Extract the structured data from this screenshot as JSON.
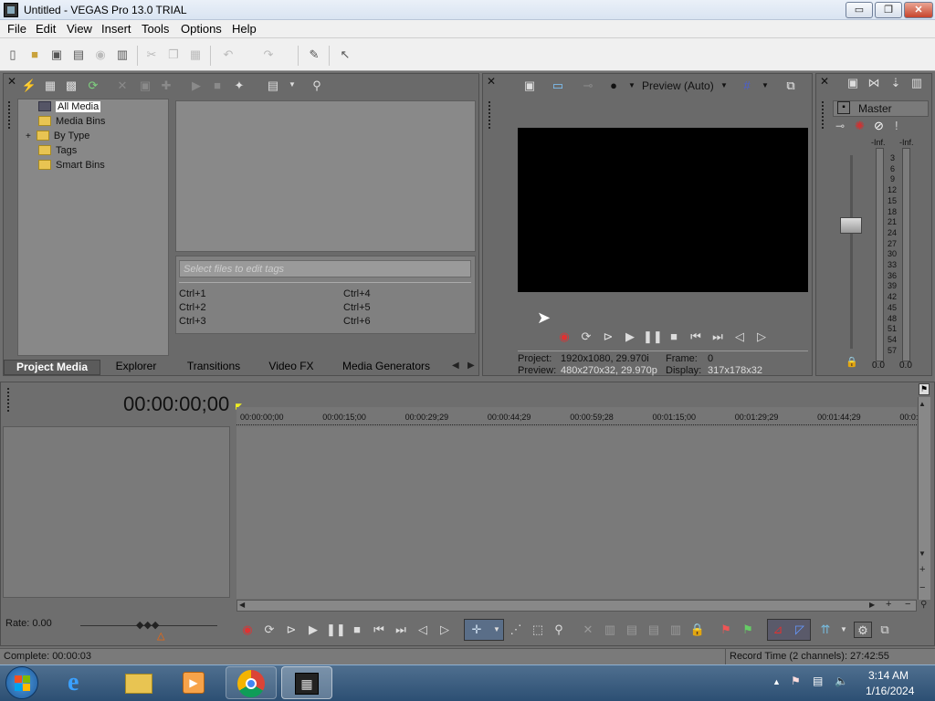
{
  "window": {
    "title": "Untitled - VEGAS Pro 13.0 TRIAL",
    "min": "▭",
    "max": "❐",
    "close": "✕"
  },
  "menu": [
    "File",
    "Edit",
    "View",
    "Insert",
    "Tools",
    "Options",
    "Help"
  ],
  "explorer": {
    "tree": [
      {
        "label": "All Media",
        "selected": true
      },
      {
        "label": "Media Bins"
      },
      {
        "label": "By Type",
        "expander": "+"
      },
      {
        "label": "Tags"
      },
      {
        "label": "Smart Bins"
      }
    ],
    "tag_placeholder": "Select files to edit tags",
    "shortcuts": [
      "Ctrl+1",
      "Ctrl+2",
      "Ctrl+3",
      "Ctrl+4",
      "Ctrl+5",
      "Ctrl+6"
    ],
    "tabs": [
      "Project Media",
      "Explorer",
      "Transitions",
      "Video FX",
      "Media Generators"
    ]
  },
  "preview": {
    "mode": "Preview (Auto)",
    "project_label": "Project:",
    "project_value": "1920x1080, 29.970i",
    "preview_label": "Preview:",
    "preview_value": "480x270x32, 29.970p",
    "frame_label": "Frame:",
    "frame_value": "0",
    "display_label": "Display:",
    "display_value": "317x178x32"
  },
  "master": {
    "label": "Master",
    "inf_left": "-Inf.",
    "inf_right": "-Inf.",
    "scale": [
      "3",
      "6",
      "9",
      "12",
      "15",
      "18",
      "21",
      "24",
      "27",
      "30",
      "33",
      "36",
      "39",
      "42",
      "45",
      "48",
      "51",
      "54",
      "57"
    ],
    "level_left": "0.0",
    "level_right": "0.0"
  },
  "timeline": {
    "time": "00:00:00;00",
    "ruler": [
      "00:00:00;00",
      "00:00:15;00",
      "00:00:29;29",
      "00:00:44;29",
      "00:00:59;28",
      "00:01:15;00",
      "00:01:29;29",
      "00:01:44;29",
      "00:0:"
    ]
  },
  "rate": "Rate: 0.00",
  "status": {
    "left": "Complete: 00:00:03",
    "right": "Record Time (2 channels): 27:42:55"
  },
  "taskbar": {
    "time": "3:14 AM",
    "date": "1/16/2024"
  }
}
